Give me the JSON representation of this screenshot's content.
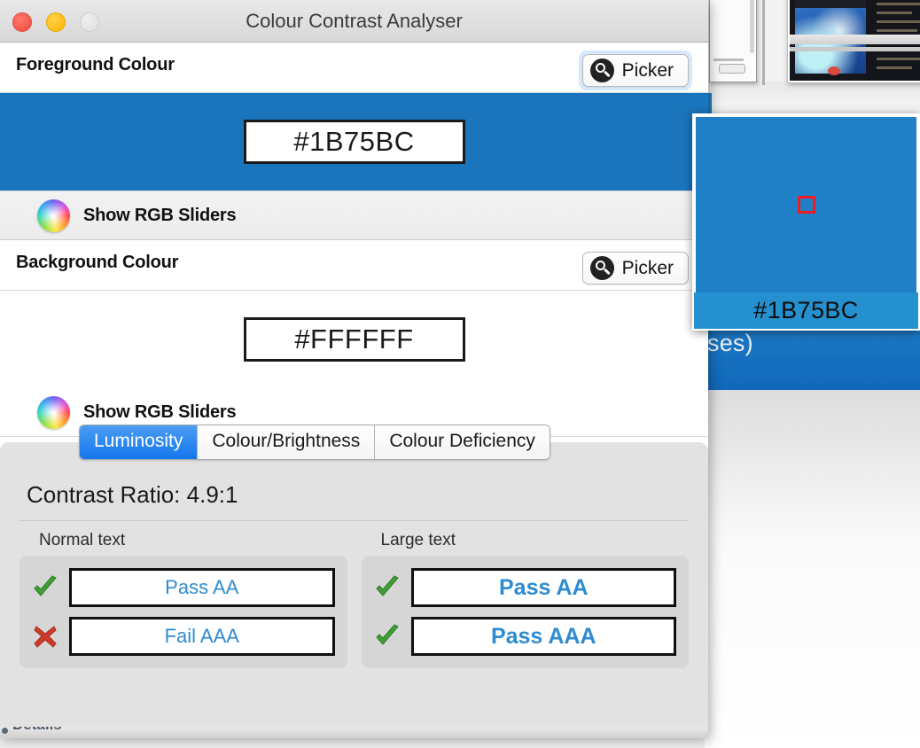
{
  "window": {
    "title": "Colour Contrast Analyser",
    "controls": {
      "close": "close-button",
      "minimize": "minimize-button",
      "zoom": "zoom-button"
    }
  },
  "foreground": {
    "header_label": "Foreground Colour",
    "picker_label": "Picker",
    "picker_focused": true,
    "hex_value": "#1B75BC",
    "swatch_color": "#1B75BC",
    "sliders_toggle_label": "Show RGB Sliders"
  },
  "background": {
    "header_label": "Background Colour",
    "picker_label": "Picker",
    "picker_focused": false,
    "hex_value": "#FFFFFF",
    "swatch_color": "#FFFFFF",
    "sliders_toggle_label": "Show RGB Sliders"
  },
  "results": {
    "tabs": [
      {
        "label": "Luminosity",
        "active": true
      },
      {
        "label": "Colour/Brightness",
        "active": false
      },
      {
        "label": "Colour Deficiency",
        "active": false
      }
    ],
    "contrast_ratio_text": "Contrast Ratio: 4.9:1",
    "contrast_ratio_value": "4.9:1",
    "groups": [
      {
        "title": "Normal text",
        "rows": [
          {
            "mark": "check-icon",
            "label": "Pass AA"
          },
          {
            "mark": "cross-icon",
            "label": "Fail AAA"
          }
        ]
      },
      {
        "title": "Large text",
        "rows": [
          {
            "mark": "check-icon",
            "label": "Pass AA"
          },
          {
            "mark": "check-icon",
            "label": "Pass AAA"
          }
        ]
      }
    ]
  },
  "loupe": {
    "hex_value": "#1B75BC",
    "sampled_color": "#1F80C8",
    "target_color": "#EE1B24"
  },
  "desktop": {
    "banner_text_fragment": "ses)"
  },
  "statusbar": {
    "cut_text": "Details"
  },
  "colors": {
    "accent_blue": "#1B75BC",
    "tab_active_blue": "#1477EC",
    "result_text_blue": "#2E8BD0",
    "pass_green": "#3F9F34",
    "fail_red": "#CF3A2A"
  }
}
